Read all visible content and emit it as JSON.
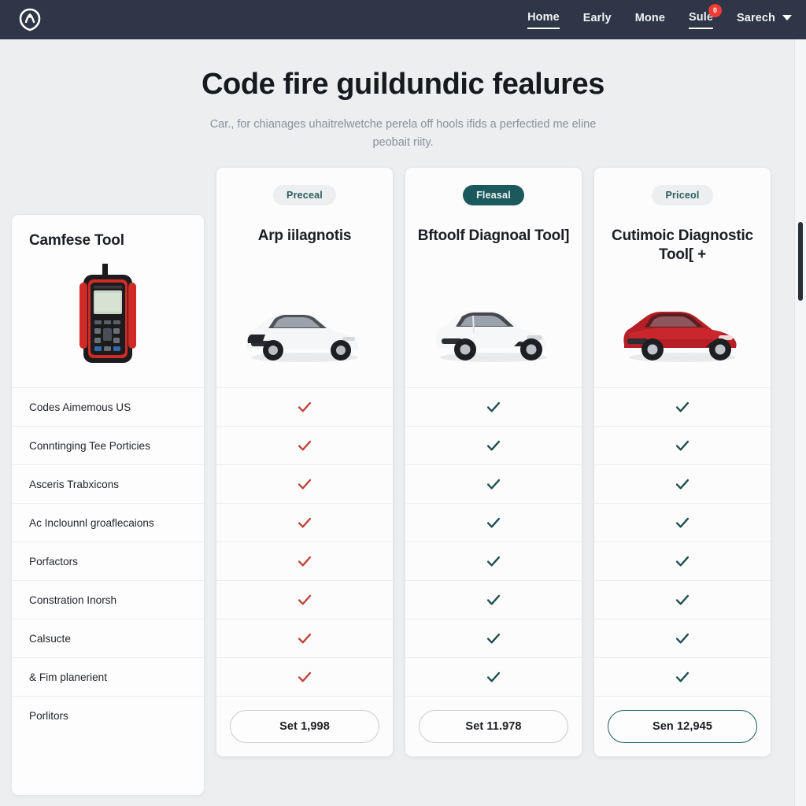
{
  "navbar": {
    "logo_icon": "brand-logo-icon",
    "links": [
      {
        "label": "Home",
        "state": "active",
        "badge": null
      },
      {
        "label": "Early",
        "state": "normal",
        "badge": null
      },
      {
        "label": "Mone",
        "state": "normal",
        "badge": null
      },
      {
        "label": "Sule",
        "state": "underlined",
        "badge": "0"
      }
    ],
    "dropdown": {
      "label": "Sarech",
      "caret_icon": "chevron-down-icon"
    }
  },
  "hero": {
    "title": "Code fire guildundic fealures",
    "subtitle": "Car., for chianages uhaitrelwetche perela off hools ifids a perfectied me eline peobait riity."
  },
  "feature_column": {
    "title": "Camfese Tool",
    "image_icon": "obd-scanner-image",
    "rows": [
      "Codes Aimemous US",
      "Conntinging Tee Porticies",
      "Asceris Trabxicons",
      "Ac Inclounnl groaflecaions",
      "Porfactors",
      "Constration Inorsh",
      "Calsucte",
      "& Fim planerient",
      "Porlitors"
    ]
  },
  "products": [
    {
      "badge": "Preceal",
      "badge_style": "light",
      "title": "Arp iilagnotis",
      "image_icon": "white-sedan-image",
      "check_color": "#c0443c",
      "checks": [
        true,
        true,
        true,
        true,
        true,
        true,
        true,
        true
      ],
      "cta": "Set 1,998",
      "cta_style": "plain"
    },
    {
      "badge": "Fleasal",
      "badge_style": "dark",
      "title": "Bftoolf Diagnoal Tool]",
      "image_icon": "white-hatchback-image",
      "check_color": "#1f4f4f",
      "checks": [
        true,
        true,
        true,
        true,
        true,
        true,
        true,
        true
      ],
      "cta": "Set 11.978",
      "cta_style": "plain"
    },
    {
      "badge": "Priceol",
      "badge_style": "light",
      "title": "Cutimoic Diagnostic Tool[ +",
      "image_icon": "red-sedan-image",
      "check_color": "#1f4f4f",
      "checks": [
        true,
        true,
        true,
        true,
        true,
        true,
        true,
        true
      ],
      "cta": "Sen 12,945",
      "cta_style": "accent"
    }
  ],
  "colors": {
    "navbar_bg": "#2e3647",
    "page_bg": "#eceef0",
    "accent_teal": "#1c595c",
    "badge_red": "#ee3b36",
    "check_red": "#c0443c",
    "check_teal": "#1f4f4f"
  },
  "scrollbar": {
    "name": "vertical-scrollbar"
  }
}
